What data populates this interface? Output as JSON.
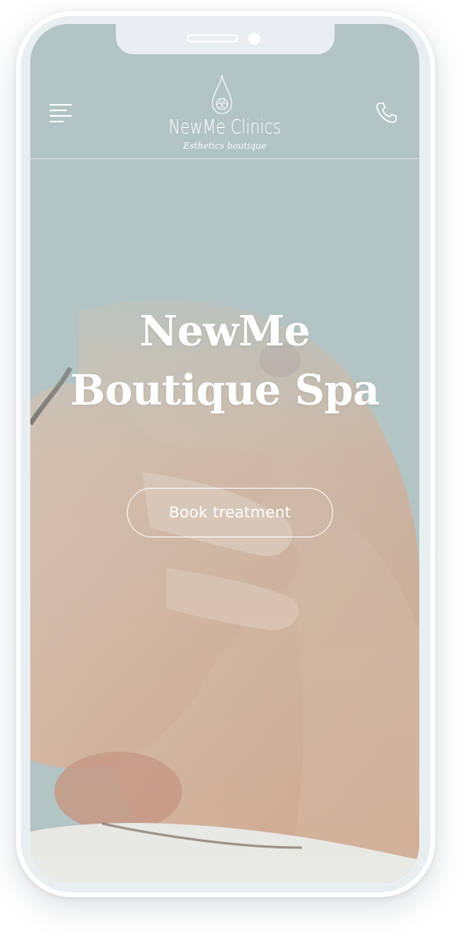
{
  "header": {
    "brand_name": "NewMe Clinics",
    "brand_tagline": "Esthetics boutique",
    "menu_icon": "hamburger-menu-icon",
    "phone_icon": "phone-icon"
  },
  "hero": {
    "title_line1": "NewMe",
    "title_line2": "Boutique Spa",
    "cta_label": "Book treatment"
  },
  "colors": {
    "background_tint": "#b2c4c3",
    "text": "#ffffff",
    "frame": "#e9eef0"
  }
}
